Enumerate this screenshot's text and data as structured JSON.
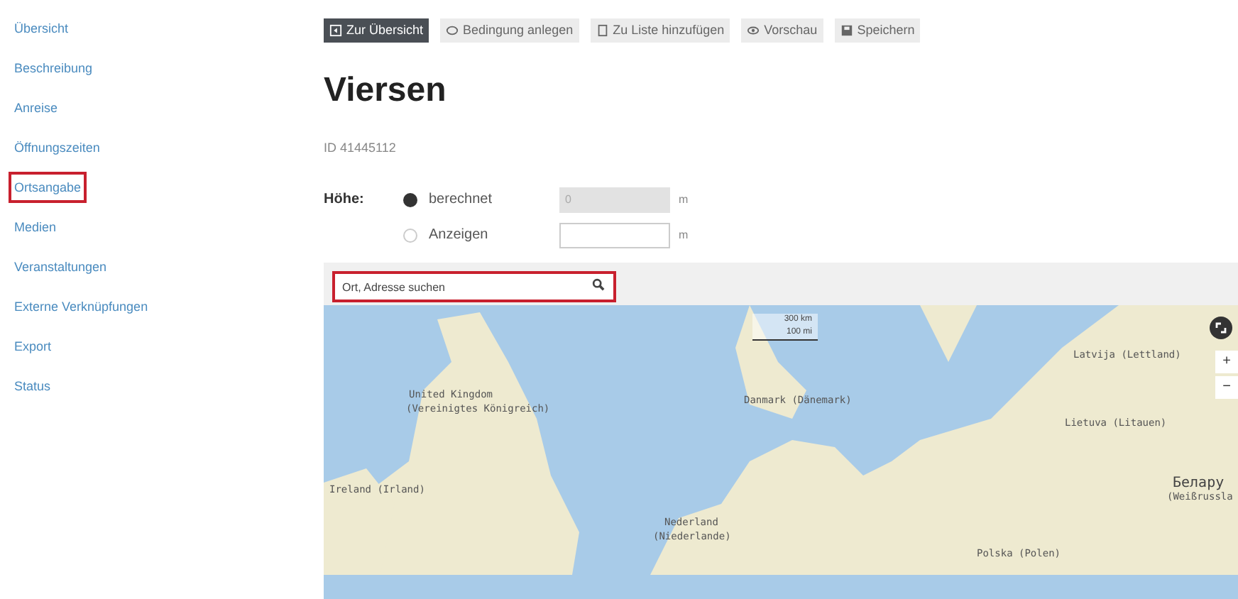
{
  "sidebar": {
    "items": [
      {
        "label": "Übersicht",
        "highlighted": false
      },
      {
        "label": "Beschreibung",
        "highlighted": false
      },
      {
        "label": "Anreise",
        "highlighted": false
      },
      {
        "label": "Öffnungszeiten",
        "highlighted": false
      },
      {
        "label": "Ortsangabe",
        "highlighted": true
      },
      {
        "label": "Medien",
        "highlighted": false
      },
      {
        "label": "Veranstaltungen",
        "highlighted": false
      },
      {
        "label": "Externe Verknüpfungen",
        "highlighted": false
      },
      {
        "label": "Export",
        "highlighted": false
      },
      {
        "label": "Status",
        "highlighted": false
      }
    ]
  },
  "toolbar": [
    {
      "label": "Zur Übersicht",
      "kind": "primary"
    },
    {
      "label": "Bedingung anlegen",
      "kind": "secondary"
    },
    {
      "label": "Zu Liste hinzufügen",
      "kind": "secondary"
    },
    {
      "label": "Vorschau",
      "kind": "secondary"
    },
    {
      "label": "Speichern",
      "kind": "secondary"
    }
  ],
  "title": "Viersen",
  "id_text": "ID 41445112",
  "height": {
    "label": "Höhe:",
    "options": [
      {
        "label": "berechnet",
        "selected": true,
        "value": "0",
        "disabled": true,
        "unit": "m"
      },
      {
        "label": "Anzeigen",
        "selected": false,
        "unit": "m"
      }
    ]
  },
  "map": {
    "search": {
      "placeholder": "Ort, Adresse suchen",
      "highlighted": true
    },
    "scale": [
      "300 km",
      "100 mi"
    ],
    "zoom_in": "+",
    "zoom_out": "−",
    "labels": [
      "United Kingdom",
      "(Vereinigtes Königreich)",
      "Ireland (Irland)",
      "Nederland",
      "(Niederlande)",
      "Danmark (Dänemark)",
      "Latvija (Lettland)",
      "Lietuva (Litauen)",
      "Белару",
      "(Weißrussla",
      "Polska (Polen)"
    ]
  }
}
